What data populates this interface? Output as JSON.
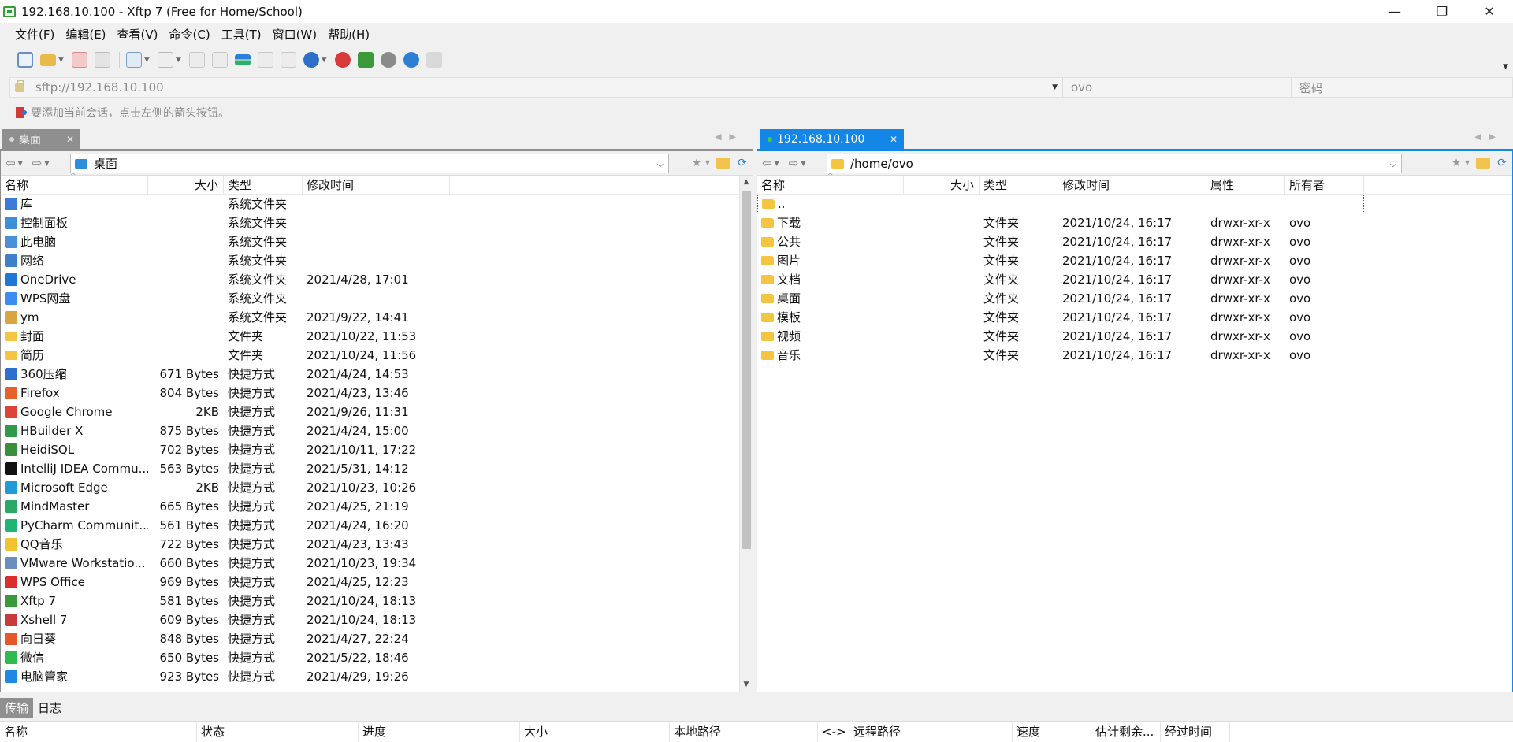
{
  "window": {
    "title": "192.168.10.100 - Xftp 7 (Free for Home/School)",
    "minimize_glyph": "—",
    "maximize_glyph": "❐",
    "close_glyph": "✕"
  },
  "menu": [
    "文件(F)",
    "编辑(E)",
    "查看(V)",
    "命令(C)",
    "工具(T)",
    "窗口(W)",
    "帮助(H)"
  ],
  "address": {
    "url": "sftp://192.168.10.100",
    "username": "ovo",
    "password_placeholder": "密码"
  },
  "hint": "要添加当前会话，点击左侧的箭头按钮。",
  "local": {
    "tab_label": "桌面",
    "path": "桌面",
    "columns": [
      "名称",
      "大小",
      "类型",
      "修改时间"
    ],
    "files": [
      {
        "name": "库",
        "size": "",
        "type": "系统文件夹",
        "modified": "",
        "icon": "library-icon",
        "color": "#3d7bd9"
      },
      {
        "name": "控制面板",
        "size": "",
        "type": "系统文件夹",
        "modified": "",
        "icon": "control-panel-icon",
        "color": "#3c8fd6"
      },
      {
        "name": "此电脑",
        "size": "",
        "type": "系统文件夹",
        "modified": "",
        "icon": "computer-icon",
        "color": "#4a90d9"
      },
      {
        "name": "网络",
        "size": "",
        "type": "系统文件夹",
        "modified": "",
        "icon": "network-icon",
        "color": "#3f7fc8"
      },
      {
        "name": "OneDrive",
        "size": "",
        "type": "系统文件夹",
        "modified": "2021/4/28, 17:01",
        "icon": "onedrive-icon",
        "color": "#1e78d6"
      },
      {
        "name": "WPS网盘",
        "size": "",
        "type": "系统文件夹",
        "modified": "",
        "icon": "wps-cloud-icon",
        "color": "#3d8cf0"
      },
      {
        "name": "ym",
        "size": "",
        "type": "系统文件夹",
        "modified": "2021/9/22, 14:41",
        "icon": "user-folder-icon",
        "color": "#d9a441"
      },
      {
        "name": "封面",
        "size": "",
        "type": "文件夹",
        "modified": "2021/10/22, 11:53",
        "icon": "folder-icon",
        "color": "#f5c542"
      },
      {
        "name": "简历",
        "size": "",
        "type": "文件夹",
        "modified": "2021/10/24, 11:56",
        "icon": "folder-icon",
        "color": "#f5c542"
      },
      {
        "name": "360压缩",
        "size": "671 Bytes",
        "type": "快捷方式",
        "modified": "2021/4/24, 14:53",
        "icon": "shortcut-360zip-icon",
        "color": "#2d6fd1"
      },
      {
        "name": "Firefox",
        "size": "804 Bytes",
        "type": "快捷方式",
        "modified": "2021/4/23, 13:46",
        "icon": "shortcut-firefox-icon",
        "color": "#e6622a"
      },
      {
        "name": "Google Chrome",
        "size": "2KB",
        "type": "快捷方式",
        "modified": "2021/9/26, 11:31",
        "icon": "shortcut-chrome-icon",
        "color": "#db4437"
      },
      {
        "name": "HBuilder X",
        "size": "875 Bytes",
        "type": "快捷方式",
        "modified": "2021/4/24, 15:00",
        "icon": "shortcut-hbuilder-icon",
        "color": "#2e9a4a"
      },
      {
        "name": "HeidiSQL",
        "size": "702 Bytes",
        "type": "快捷方式",
        "modified": "2021/10/11, 17:22",
        "icon": "shortcut-heidisql-icon",
        "color": "#3a8f3a"
      },
      {
        "name": "IntelliJ IDEA Commu...",
        "size": "563 Bytes",
        "type": "快捷方式",
        "modified": "2021/5/31, 14:12",
        "icon": "shortcut-intellij-icon",
        "color": "#111111"
      },
      {
        "name": "Microsoft Edge",
        "size": "2KB",
        "type": "快捷方式",
        "modified": "2021/10/23, 10:26",
        "icon": "shortcut-edge-icon",
        "color": "#1f9bd6"
      },
      {
        "name": "MindMaster",
        "size": "665 Bytes",
        "type": "快捷方式",
        "modified": "2021/4/25, 21:19",
        "icon": "shortcut-mindmaster-icon",
        "color": "#2aa866"
      },
      {
        "name": "PyCharm Communit...",
        "size": "561 Bytes",
        "type": "快捷方式",
        "modified": "2021/4/24, 16:20",
        "icon": "shortcut-pycharm-icon",
        "color": "#21b573"
      },
      {
        "name": "QQ音乐",
        "size": "722 Bytes",
        "type": "快捷方式",
        "modified": "2021/4/23, 13:43",
        "icon": "shortcut-qqmusic-icon",
        "color": "#f2c230"
      },
      {
        "name": "VMware Workstatio...",
        "size": "660 Bytes",
        "type": "快捷方式",
        "modified": "2021/10/23, 19:34",
        "icon": "shortcut-vmware-icon",
        "color": "#6a8fbf"
      },
      {
        "name": "WPS Office",
        "size": "969 Bytes",
        "type": "快捷方式",
        "modified": "2021/4/25, 12:23",
        "icon": "shortcut-wps-icon",
        "color": "#d9302c"
      },
      {
        "name": "Xftp 7",
        "size": "581 Bytes",
        "type": "快捷方式",
        "modified": "2021/10/24, 18:13",
        "icon": "shortcut-xftp-icon",
        "color": "#3a9a3a"
      },
      {
        "name": "Xshell 7",
        "size": "609 Bytes",
        "type": "快捷方式",
        "modified": "2021/10/24, 18:13",
        "icon": "shortcut-xshell-icon",
        "color": "#c93a3a"
      },
      {
        "name": "向日葵",
        "size": "848 Bytes",
        "type": "快捷方式",
        "modified": "2021/4/27, 22:24",
        "icon": "shortcut-sunflower-icon",
        "color": "#e8562a"
      },
      {
        "name": "微信",
        "size": "650 Bytes",
        "type": "快捷方式",
        "modified": "2021/5/22, 18:46",
        "icon": "shortcut-wechat-icon",
        "color": "#2dbb4e"
      },
      {
        "name": "电脑管家",
        "size": "923 Bytes",
        "type": "快捷方式",
        "modified": "2021/4/29, 19:26",
        "icon": "shortcut-pcmanager-icon",
        "color": "#1e88e5"
      }
    ]
  },
  "remote": {
    "tab_label": "192.168.10.100",
    "path": "/home/ovo",
    "columns": [
      "名称",
      "大小",
      "类型",
      "修改时间",
      "属性",
      "所有者"
    ],
    "parent": "..",
    "files": [
      {
        "name": "下载",
        "size": "",
        "type": "文件夹",
        "modified": "2021/10/24, 16:17",
        "attr": "drwxr-xr-x",
        "owner": "ovo"
      },
      {
        "name": "公共",
        "size": "",
        "type": "文件夹",
        "modified": "2021/10/24, 16:17",
        "attr": "drwxr-xr-x",
        "owner": "ovo"
      },
      {
        "name": "图片",
        "size": "",
        "type": "文件夹",
        "modified": "2021/10/24, 16:17",
        "attr": "drwxr-xr-x",
        "owner": "ovo"
      },
      {
        "name": "文档",
        "size": "",
        "type": "文件夹",
        "modified": "2021/10/24, 16:17",
        "attr": "drwxr-xr-x",
        "owner": "ovo"
      },
      {
        "name": "桌面",
        "size": "",
        "type": "文件夹",
        "modified": "2021/10/24, 16:17",
        "attr": "drwxr-xr-x",
        "owner": "ovo"
      },
      {
        "name": "模板",
        "size": "",
        "type": "文件夹",
        "modified": "2021/10/24, 16:17",
        "attr": "drwxr-xr-x",
        "owner": "ovo"
      },
      {
        "name": "视频",
        "size": "",
        "type": "文件夹",
        "modified": "2021/10/24, 16:17",
        "attr": "drwxr-xr-x",
        "owner": "ovo"
      },
      {
        "name": "音乐",
        "size": "",
        "type": "文件夹",
        "modified": "2021/10/24, 16:17",
        "attr": "drwxr-xr-x",
        "owner": "ovo"
      }
    ]
  },
  "bottom": {
    "tabs": [
      "传输",
      "日志"
    ],
    "columns": [
      "名称",
      "状态",
      "进度",
      "大小",
      "本地路径",
      "<->",
      "远程路径",
      "速度",
      "估计剩余...",
      "经过时间"
    ]
  },
  "colors": {
    "accent": "#1487e6",
    "inactive_tab": "#8f8f8f",
    "folder": "#f5c542"
  }
}
